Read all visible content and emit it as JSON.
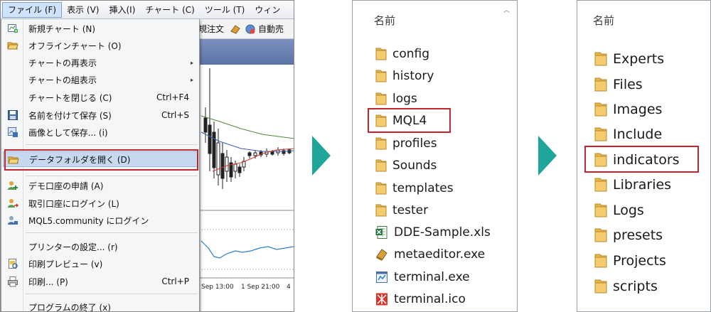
{
  "menubar": {
    "items": [
      {
        "label": "ファイル (F)",
        "active": true
      },
      {
        "label": "表示 (V)",
        "active": false
      },
      {
        "label": "挿入(I)",
        "active": false
      },
      {
        "label": "チャート (C)",
        "active": false
      },
      {
        "label": "ツール (T)",
        "active": false
      },
      {
        "label": "ウィン",
        "active": false
      }
    ]
  },
  "toolbar": {
    "order_label": "規注文",
    "autotrade_label": "自動売"
  },
  "chart": {
    "x_labels": [
      "Sep 13:00",
      "1 Sep 21:00",
      "4"
    ]
  },
  "file_menu": {
    "items": [
      {
        "label": "新規チャート (N)",
        "shortcut": "",
        "icon": "new-chart-icon"
      },
      {
        "label": "オフラインチャート (O)",
        "shortcut": "",
        "icon": "open-folder-icon"
      },
      {
        "label": "チャートの再表示",
        "shortcut": "",
        "icon": "",
        "submenu": true
      },
      {
        "label": "チャートの組表示",
        "shortcut": "",
        "icon": "",
        "submenu": true
      },
      {
        "label": "チャートを閉じる (C)",
        "shortcut": "Ctrl+F4",
        "icon": ""
      },
      {
        "label": "名前を付けて保存 (S)",
        "shortcut": "Ctrl+S",
        "icon": "save-icon"
      },
      {
        "label": "画像として保存... (i)",
        "shortcut": "",
        "icon": "save-image-icon"
      },
      {
        "label": "データフォルダを開く (D)",
        "shortcut": "",
        "icon": "open-folder-icon",
        "highlighted": true
      },
      {
        "label": "デモ口座の申請 (A)",
        "shortcut": "",
        "icon": "user-add-icon"
      },
      {
        "label": "取引口座にログイン (L)",
        "shortcut": "",
        "icon": "user-login-icon"
      },
      {
        "label": "MQL5.community にログイン",
        "shortcut": "",
        "icon": "mql5-login-icon"
      },
      {
        "label": "プリンターの設定... (r)",
        "shortcut": "",
        "icon": ""
      },
      {
        "label": "印刷プレビュー (v)",
        "shortcut": "",
        "icon": "print-preview-icon"
      },
      {
        "label": "印刷... (P)",
        "shortcut": "Ctrl+P",
        "icon": "printer-icon"
      },
      {
        "label": "プログラムの終了 (x)",
        "shortcut": "",
        "icon": ""
      }
    ]
  },
  "data_folder": {
    "column_header": "名前",
    "items": [
      {
        "name": "config",
        "type": "folder"
      },
      {
        "name": "history",
        "type": "folder"
      },
      {
        "name": "logs",
        "type": "folder"
      },
      {
        "name": "MQL4",
        "type": "folder",
        "highlighted": true
      },
      {
        "name": "profiles",
        "type": "folder"
      },
      {
        "name": "Sounds",
        "type": "folder"
      },
      {
        "name": "templates",
        "type": "folder"
      },
      {
        "name": "tester",
        "type": "folder"
      },
      {
        "name": "DDE-Sample.xls",
        "type": "excel"
      },
      {
        "name": "metaeditor.exe",
        "type": "metaeditor"
      },
      {
        "name": "terminal.exe",
        "type": "exe"
      },
      {
        "name": "terminal.ico",
        "type": "ico"
      }
    ]
  },
  "mql4_folder": {
    "column_header": "名前",
    "items": [
      {
        "name": "Experts",
        "type": "folder"
      },
      {
        "name": "Files",
        "type": "folder"
      },
      {
        "name": "Images",
        "type": "folder"
      },
      {
        "name": "Include",
        "type": "folder"
      },
      {
        "name": "indicators",
        "type": "folder",
        "highlighted": true
      },
      {
        "name": "Libraries",
        "type": "folder"
      },
      {
        "name": "Logs",
        "type": "folder"
      },
      {
        "name": "presets",
        "type": "folder"
      },
      {
        "name": "Projects",
        "type": "folder"
      },
      {
        "name": "scripts",
        "type": "folder"
      }
    ]
  },
  "colors": {
    "highlight_border": "#c1272d",
    "arrow": "#1fa59a",
    "folder": "#e8b64a",
    "menu_highlight": "#c6d9ef"
  }
}
